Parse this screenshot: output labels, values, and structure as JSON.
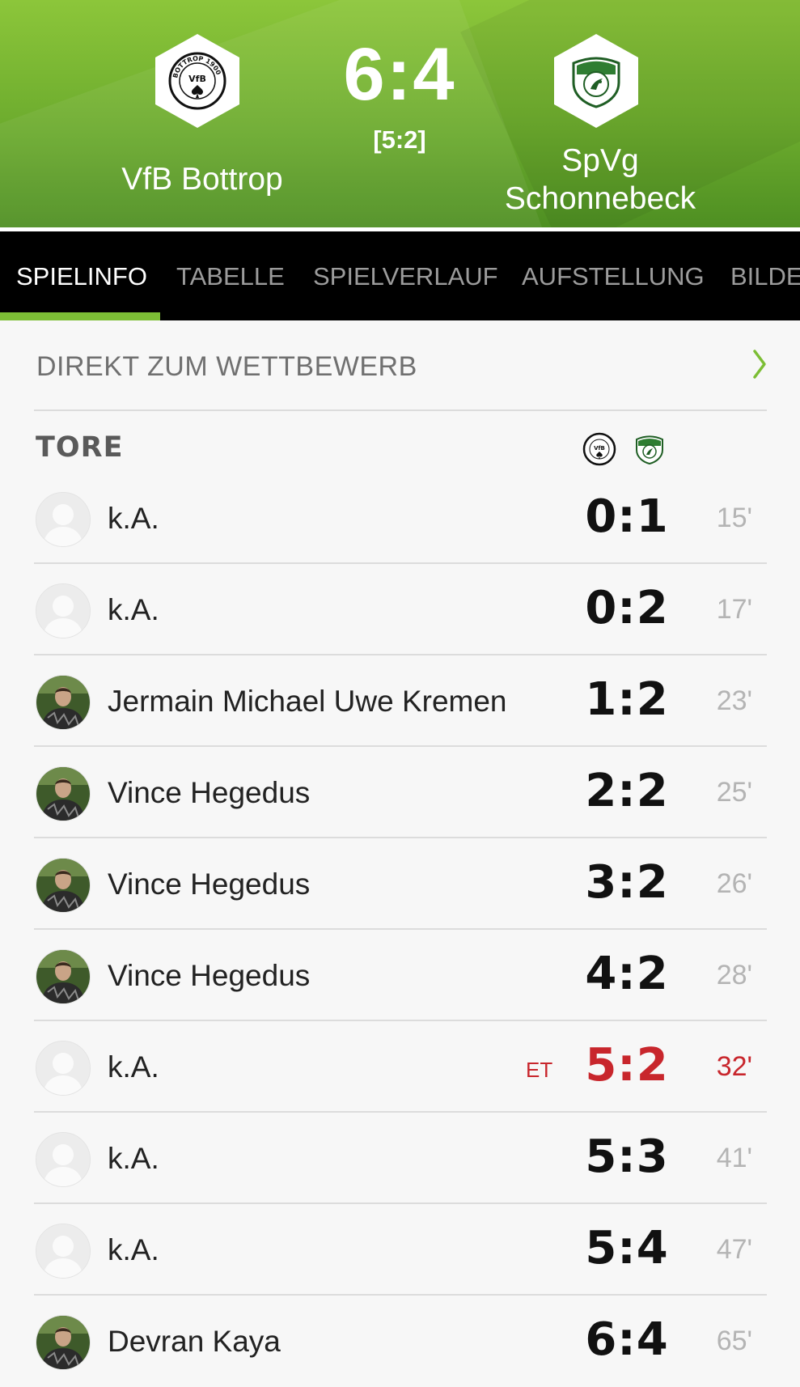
{
  "match": {
    "home_team": "VfB Bottrop",
    "away_team": "SpVg\nSchonnebeck",
    "score": "6:4",
    "halftime": "[5:2]"
  },
  "home_logo_text": "BOTTROP 1900",
  "tabs": [
    {
      "label": "SPIELINFO",
      "active": true
    },
    {
      "label": "TABELLE",
      "active": false
    },
    {
      "label": "SPIELVERLAUF",
      "active": false
    },
    {
      "label": "AUFSTELLUNG",
      "active": false
    },
    {
      "label": "BILDE",
      "active": false
    }
  ],
  "direct_link": "DIREKT ZUM WETTBEWERB",
  "goals_title": "TORE",
  "goals": [
    {
      "scorer": "k.A.",
      "score": "0:1",
      "minute": "15'",
      "photo": false,
      "own_goal": false
    },
    {
      "scorer": "k.A.",
      "score": "0:2",
      "minute": "17'",
      "photo": false,
      "own_goal": false
    },
    {
      "scorer": "Jermain Michael Uwe Kremen",
      "score": "1:2",
      "minute": "23'",
      "photo": true,
      "own_goal": false
    },
    {
      "scorer": "Vince Hegedus",
      "score": "2:2",
      "minute": "25'",
      "photo": true,
      "own_goal": false
    },
    {
      "scorer": "Vince Hegedus",
      "score": "3:2",
      "minute": "26'",
      "photo": true,
      "own_goal": false
    },
    {
      "scorer": "Vince Hegedus",
      "score": "4:2",
      "minute": "28'",
      "photo": true,
      "own_goal": false
    },
    {
      "scorer": "k.A.",
      "score": "5:2",
      "minute": "32'",
      "photo": false,
      "own_goal": true,
      "tag": "ET"
    },
    {
      "scorer": "k.A.",
      "score": "5:3",
      "minute": "41'",
      "photo": false,
      "own_goal": false
    },
    {
      "scorer": "k.A.",
      "score": "5:4",
      "minute": "47'",
      "photo": false,
      "own_goal": false
    },
    {
      "scorer": "Devran Kaya",
      "score": "6:4",
      "minute": "65'",
      "photo": true,
      "own_goal": false
    }
  ],
  "colors": {
    "header_green": "#7cbe35",
    "tab_active_underline": "#7cbe35",
    "own_goal_red": "#c8262c",
    "away_club_green": "#2f7d32"
  },
  "icons": [
    "vfb-bottrop-logo",
    "spvg-schonnebeck-logo",
    "chevron-right-icon",
    "player-placeholder-icon",
    "player-photo"
  ]
}
